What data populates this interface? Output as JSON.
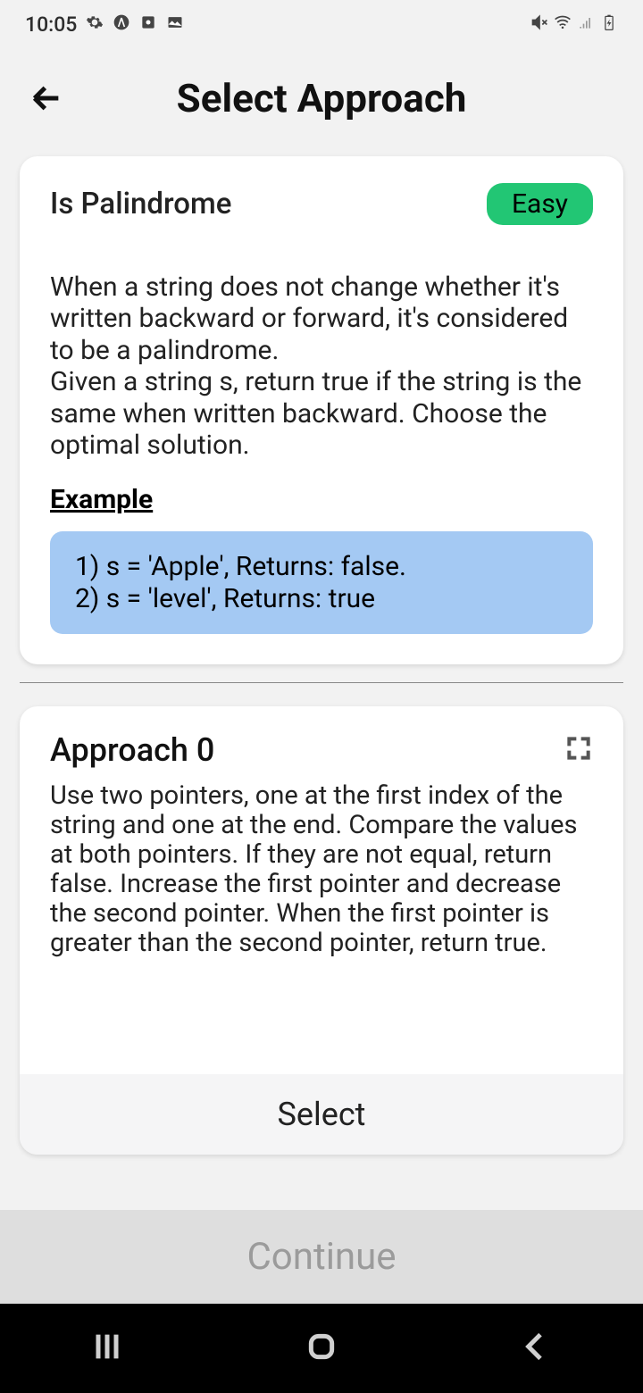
{
  "status": {
    "time": "10:05"
  },
  "header": {
    "title": "Select Approach"
  },
  "problem": {
    "title": "Is Palindrome",
    "difficulty": "Easy",
    "description": "When a string does not change whether it's written backward or forward, it's considered to be a palindrome.\nGiven a string s, return true if the string is the same when written backward. Choose the optimal solution.",
    "example_heading": "Example",
    "example_text": "1) s = 'Apple',  Returns: false.\n2) s = 'level', Returns: true"
  },
  "approach": {
    "title": "Approach 0",
    "description": "Use two pointers, one at the first index of the string and one at the end. Compare the values at both pointers. If they are not equal, return false.  Increase the first pointer and decrease the second pointer.  When the first pointer is greater than the second pointer, return true.",
    "select_label": "Select"
  },
  "continue_label": "Continue"
}
